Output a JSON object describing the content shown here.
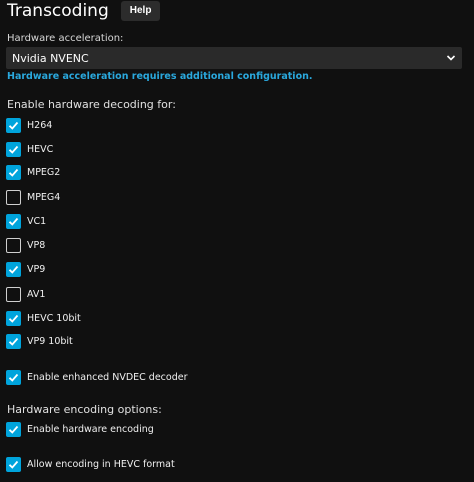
{
  "header": {
    "title": "Transcoding",
    "help_label": "Help"
  },
  "hwaccel": {
    "label": "Hardware acceleration:",
    "selected": "Nvidia NVENC",
    "info": "Hardware acceleration requires additional configuration."
  },
  "decoding": {
    "heading": "Enable hardware decoding for:",
    "codecs": [
      {
        "label": "H264",
        "checked": true
      },
      {
        "label": "HEVC",
        "checked": true
      },
      {
        "label": "MPEG2",
        "checked": true
      },
      {
        "label": "MPEG4",
        "checked": false
      },
      {
        "label": "VC1",
        "checked": true
      },
      {
        "label": "VP8",
        "checked": false
      },
      {
        "label": "VP9",
        "checked": true
      },
      {
        "label": "AV1",
        "checked": false
      },
      {
        "label": "HEVC 10bit",
        "checked": true
      },
      {
        "label": "VP9 10bit",
        "checked": true
      }
    ],
    "nvdec": {
      "label": "Enable enhanced NVDEC decoder",
      "checked": true
    }
  },
  "encoding": {
    "heading": "Hardware encoding options:",
    "enable": {
      "label": "Enable hardware encoding",
      "checked": true
    },
    "hevc": {
      "label": "Allow encoding in HEVC format",
      "checked": true
    }
  },
  "colors": {
    "accent": "#00a4dc",
    "link": "#2aa8dd",
    "background": "#101010"
  }
}
